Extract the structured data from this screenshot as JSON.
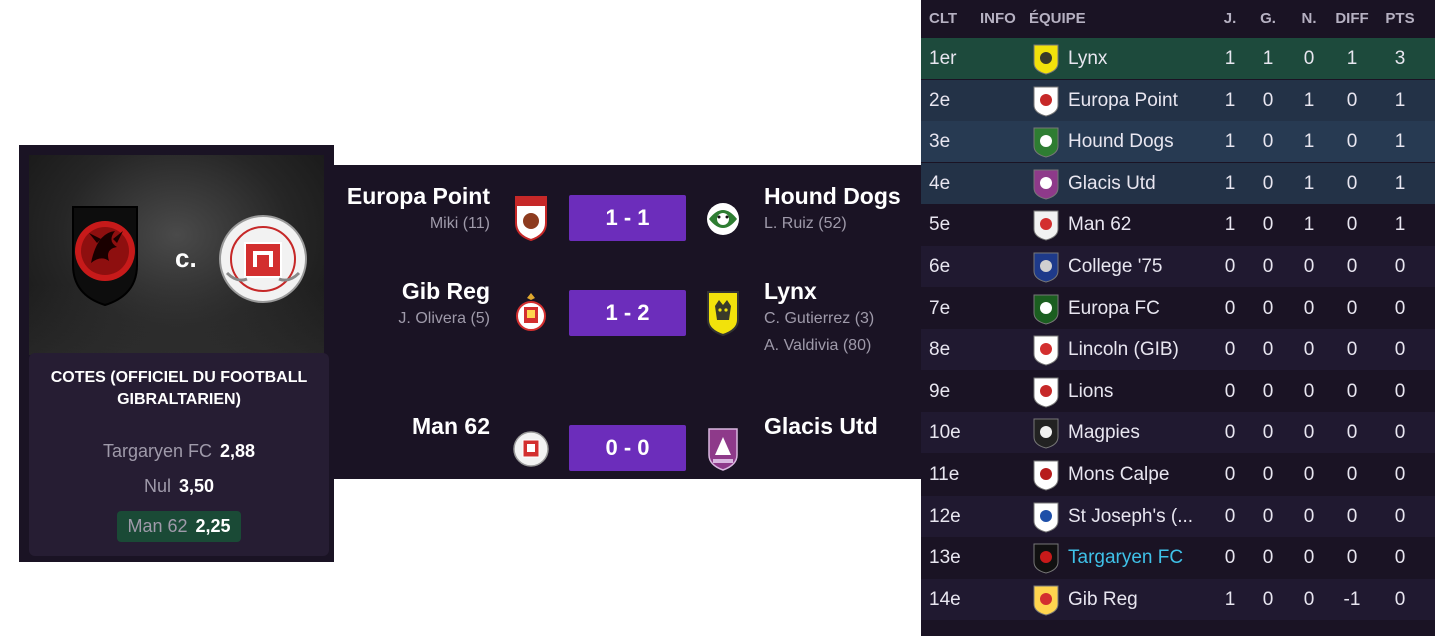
{
  "odds": {
    "vs_label": "c.",
    "title": "COTES (OFFICIEL DU FOOTBALL GIBRALTARIEN)",
    "rows": [
      {
        "label": "Targaryen FC",
        "value": "2,88"
      },
      {
        "label": "Nul",
        "value": "3,50"
      },
      {
        "label": "Man 62",
        "value": "2,25"
      }
    ]
  },
  "results": [
    {
      "home": "Europa Point",
      "home_scorers": [
        "Miki (11)"
      ],
      "score": "1 - 1",
      "away": "Hound Dogs",
      "away_scorers": [
        "L. Ruiz (52)"
      ]
    },
    {
      "home": "Gib Reg",
      "home_scorers": [
        "J. Olivera (5)"
      ],
      "score": "1 - 2",
      "away": "Lynx",
      "away_scorers": [
        "C. Gutierrez (3)",
        "A. Valdivia (80)"
      ]
    },
    {
      "home": "Man 62",
      "home_scorers": [],
      "score": "0 - 0",
      "away": "Glacis Utd",
      "away_scorers": []
    }
  ],
  "table": {
    "headers": {
      "pos": "CLT",
      "info": "INFO",
      "team": "ÉQUIPE",
      "played": "J.",
      "won": "G.",
      "drawn": "N.",
      "diff": "DIFF",
      "pts": "PTS"
    },
    "rows": [
      {
        "pos": "1er",
        "team": "Lynx",
        "played": "1",
        "won": "1",
        "drawn": "0",
        "diff": "1",
        "pts": "3"
      },
      {
        "pos": "2e",
        "team": "Europa Point",
        "played": "1",
        "won": "0",
        "drawn": "1",
        "diff": "0",
        "pts": "1"
      },
      {
        "pos": "3e",
        "team": "Hound Dogs",
        "played": "1",
        "won": "0",
        "drawn": "1",
        "diff": "0",
        "pts": "1"
      },
      {
        "pos": "4e",
        "team": "Glacis Utd",
        "played": "1",
        "won": "0",
        "drawn": "1",
        "diff": "0",
        "pts": "1"
      },
      {
        "pos": "5e",
        "team": "Man 62",
        "played": "1",
        "won": "0",
        "drawn": "1",
        "diff": "0",
        "pts": "1"
      },
      {
        "pos": "6e",
        "team": "College '75",
        "played": "0",
        "won": "0",
        "drawn": "0",
        "diff": "0",
        "pts": "0"
      },
      {
        "pos": "7e",
        "team": "Europa FC",
        "played": "0",
        "won": "0",
        "drawn": "0",
        "diff": "0",
        "pts": "0"
      },
      {
        "pos": "8e",
        "team": "Lincoln (GIB)",
        "played": "0",
        "won": "0",
        "drawn": "0",
        "diff": "0",
        "pts": "0"
      },
      {
        "pos": "9e",
        "team": "Lions",
        "played": "0",
        "won": "0",
        "drawn": "0",
        "diff": "0",
        "pts": "0"
      },
      {
        "pos": "10e",
        "team": "Magpies",
        "played": "0",
        "won": "0",
        "drawn": "0",
        "diff": "0",
        "pts": "0"
      },
      {
        "pos": "11e",
        "team": "Mons Calpe",
        "played": "0",
        "won": "0",
        "drawn": "0",
        "diff": "0",
        "pts": "0"
      },
      {
        "pos": "12e",
        "team": "St Joseph's (...",
        "played": "0",
        "won": "0",
        "drawn": "0",
        "diff": "0",
        "pts": "0"
      },
      {
        "pos": "13e",
        "team": "Targaryen FC",
        "played": "0",
        "won": "0",
        "drawn": "0",
        "diff": "0",
        "pts": "0"
      },
      {
        "pos": "14e",
        "team": "Gib Reg",
        "played": "1",
        "won": "0",
        "drawn": "0",
        "diff": "-1",
        "pts": "0"
      }
    ]
  }
}
